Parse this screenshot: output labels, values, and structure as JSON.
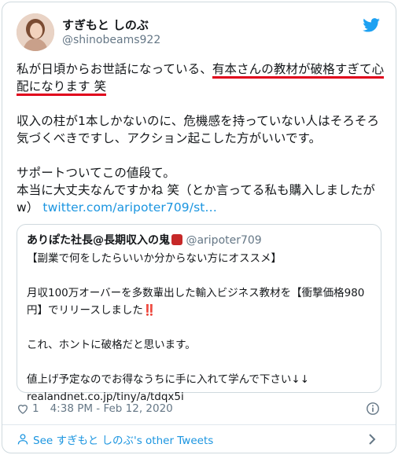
{
  "author": {
    "display_name": "すぎもと しのぶ",
    "handle": "@shinobeams922"
  },
  "tweet": {
    "p1_a": "私が日頃からお世話になっている、",
    "p1_b": "有本さんの教材が破格すぎて心配になります 笑",
    "p2": "収入の柱が1本しかないのに、危機感を持っていない人はそろそろ気づくべきですし、アクション起こした方がいいです。",
    "p3_a": "サポートついてこの値段て。",
    "p3_b": "本当に大丈夫なんですかね 笑（とか言ってる私も購入しましたがw）",
    "link": "twitter.com/aripoter709/st…"
  },
  "quote": {
    "name": "ありぽた社長@長期収入の鬼",
    "handle": "@aripoter709",
    "line1": "【副業で何をしたらいいか分からない方にオススメ】",
    "line2": "月収100万オーバーを多数輩出した輸入ビジネス教材を【衝撃価格980円】でリリースしました",
    "line2_mark": "‼️",
    "line3": "これ、ホントに破格だと思います。",
    "line4": "値上げ予定なのでお得なうちに手に入れて学んで下さい↓↓",
    "link": "realandnet.co.jp/tiny/a/tdqx5i"
  },
  "meta": {
    "likes": "1",
    "timestamp": "4:38 PM - Feb 12, 2020"
  },
  "footer": {
    "see_more": "See すぎもと しのぶ's other Tweets"
  },
  "colors": {
    "accent": "#1b95e0",
    "underline": "#e0001b",
    "muted": "#657786"
  }
}
